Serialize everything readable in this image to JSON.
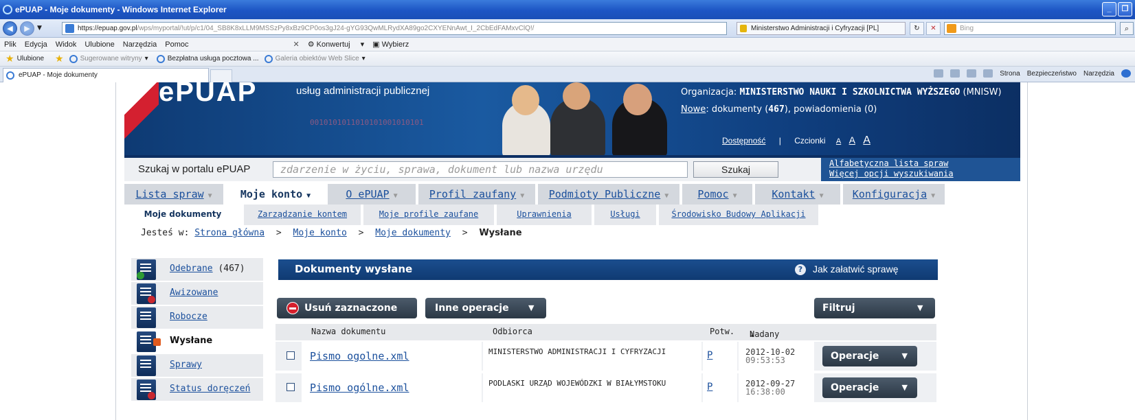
{
  "browser": {
    "window_title": "ePUAP - Moje dokumenty - Windows Internet Explorer",
    "url_main": "https://epuap.gov.pl",
    "url_rest": "/wps/myportal/!ut/p/c1/04_SB8K8xLLM9MSSzPy8xBz9CP0os3gJ24-gYG93QwMLRydXA89go2CXYENnAwt_I_2CbEdFAMxvClQ!/",
    "cert_label": "Ministerstwo Administracji i Cyfryzacji [PL]",
    "search_placeholder": "Bing",
    "menu": [
      "Plik",
      "Edycja",
      "Widok",
      "Ulubione",
      "Narzędzia",
      "Pomoc"
    ],
    "menu_extra": [
      "Konwertuj",
      "Wybierz"
    ],
    "favorites": {
      "label": "Ulubione",
      "items": [
        "Sugerowane witryny",
        "Bezpłatna usługa pocztowa ...",
        "Galeria obiektów Web Slice"
      ]
    },
    "tab_title": "ePUAP - Moje dokumenty",
    "command_bar": [
      "Strona",
      "Bezpieczeństwo",
      "Narzędzia"
    ]
  },
  "banner": {
    "logo": "ePUAP",
    "subtitle": "usług administracji publicznej",
    "binary": "0010101011010101001010101",
    "org_label": "Organizacja:",
    "org_name": "MINISTERSTWO NAUKI I SZKOLNICTWA WYŻSZEGO",
    "org_code": "(MNISW)",
    "new_link": "Nowe",
    "new_text_1": ": dokumenty (",
    "new_docs": "467",
    "new_text_2": "), powiadomienia (0)",
    "accessibility": "Dostępność",
    "fonts_label": "Czcionki",
    "font_a": "A"
  },
  "search": {
    "label": "Szukaj w portalu ePUAP",
    "placeholder": "zdarzenie w życiu, sprawa, dokument lub nazwa urzędu",
    "button": "Szukaj",
    "link1": "Alfabetyczna lista spraw",
    "link2": "Więcej opcji wyszukiwania"
  },
  "main_nav": [
    {
      "label": "Lista spraw"
    },
    {
      "label": "Moje konto"
    },
    {
      "label": "O ePUAP"
    },
    {
      "label": "Profil zaufany"
    },
    {
      "label": "Podmioty Publiczne"
    },
    {
      "label": "Pomoc"
    },
    {
      "label": "Kontakt"
    },
    {
      "label": "Konfiguracja"
    }
  ],
  "sub_nav": [
    {
      "label": "Moje dokumenty"
    },
    {
      "label": "Zarządzanie kontem"
    },
    {
      "label": "Moje profile zaufane"
    },
    {
      "label": "Uprawnienia"
    },
    {
      "label": "Usługi"
    },
    {
      "label": "Środowisko Budowy Aplikacji"
    }
  ],
  "breadcrumb": {
    "prefix": "Jesteś w:",
    "sep": ">",
    "items": [
      "Strona główna",
      "Moje konto",
      "Moje dokumenty"
    ],
    "current": "Wysłane"
  },
  "left_menu": [
    {
      "label": "Odebrane",
      "count": "(467)"
    },
    {
      "label": "Awizowane"
    },
    {
      "label": "Robocze"
    },
    {
      "label": "Wysłane"
    },
    {
      "label": "Sprawy"
    },
    {
      "label": "Status doręczeń"
    }
  ],
  "content": {
    "title": "Dokumenty wysłane",
    "help_link": "Jak załatwić sprawę",
    "delete_button": "Usuń zaznaczone",
    "other_ops_button": "Inne operacje",
    "filter_button": "Filtruj",
    "columns": {
      "name": "Nazwa dokumentu",
      "recipient": "Odbiorca",
      "confirm": "Potw.",
      "sent": "Nadany"
    },
    "rows": [
      {
        "name": "Pismo ogolne.xml",
        "recipient": "MINISTERSTWO ADMINISTRACJI I CYFRYZACJI",
        "confirm": "P",
        "date": "2012-10-02",
        "time": "09:53:53",
        "op": "Operacje"
      },
      {
        "name": "Pismo ogólne.xml",
        "recipient": "PODLASKI URZĄD WOJEWÓDZKI W BIAŁYMSTOKU",
        "confirm": "P",
        "date": "2012-09-27",
        "time": "16:38:00",
        "op": "Operacje"
      }
    ]
  }
}
